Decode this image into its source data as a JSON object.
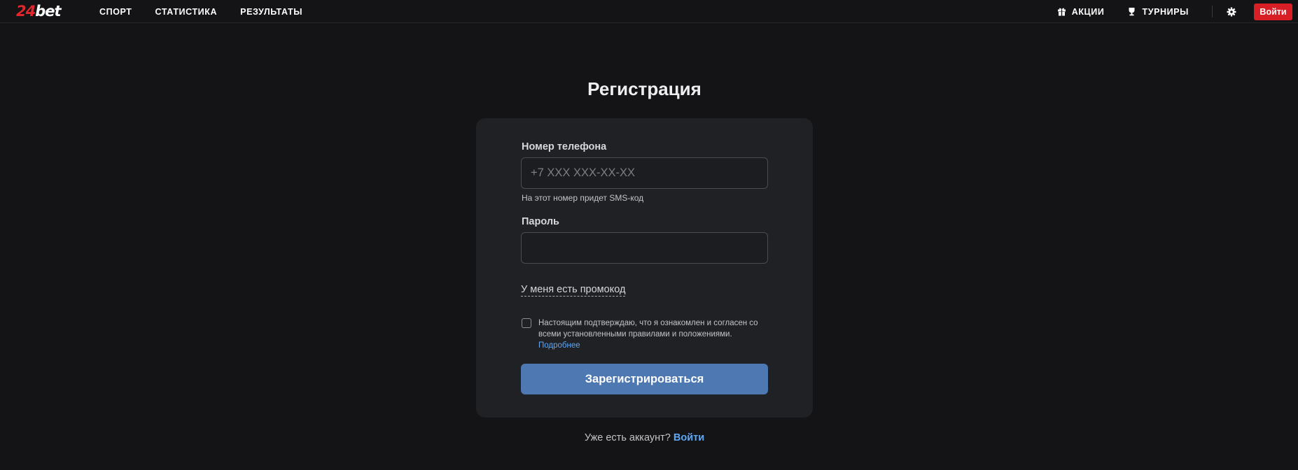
{
  "header": {
    "logo_number": "24",
    "logo_text": "bet",
    "nav": [
      "СПОРТ",
      "СТАТИСТИКА",
      "РЕЗУЛЬТАТЫ"
    ],
    "promotions": "АКЦИИ",
    "tournaments": "ТУРНИРЫ",
    "login_button": "Войти"
  },
  "registration": {
    "title": "Регистрация",
    "phone_label": "Номер телефона",
    "phone_placeholder": "+7 XXX XXX-XX-XX",
    "phone_value": "",
    "phone_hint": "На этот номер придет SMS-код",
    "password_label": "Пароль",
    "password_value": "",
    "promo_link": "У меня есть промокод",
    "agreement_text": "Настоящим подтверждаю, что я ознакомлен и согласен со всеми установленными правилами и положениями.",
    "agreement_checked": false,
    "more_link": "Подробнее",
    "submit_button": "Зарегистрироваться"
  },
  "footer": {
    "have_account": "Уже есть аккаунт?",
    "login_link": "Войти"
  },
  "colors": {
    "background": "#141416",
    "card": "#1f2124",
    "brand_red": "#d91f26",
    "primary_button": "#4d78b1",
    "link": "#5ea7f5"
  },
  "icons": {
    "promotions": "gift-icon",
    "tournaments": "trophy-icon",
    "settings": "gear-icon"
  }
}
